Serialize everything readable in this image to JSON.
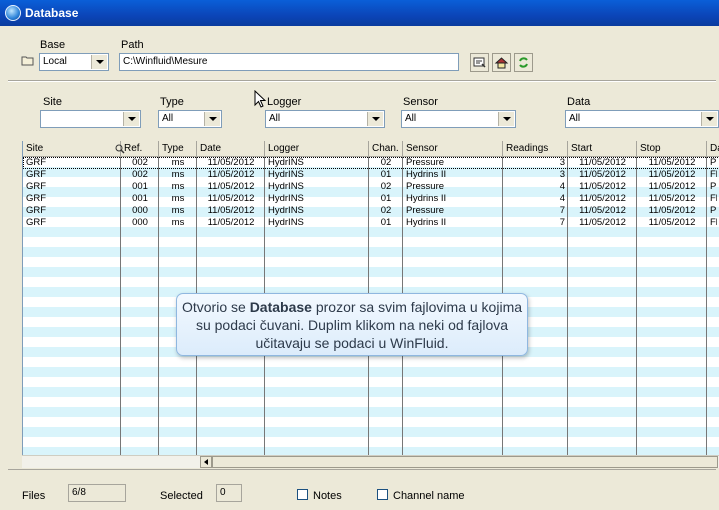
{
  "window": {
    "title": "Database"
  },
  "top": {
    "base_label": "Base",
    "base_value": "Local",
    "path_label": "Path",
    "path_value": "C:\\Winfluid\\Mesure"
  },
  "filters": {
    "site_label": "Site",
    "site_value": "",
    "type_label": "Type",
    "type_value": "All",
    "logger_label": "Logger",
    "logger_value": "All",
    "sensor_label": "Sensor",
    "sensor_value": "All",
    "data_label": "Data",
    "data_value": "All"
  },
  "table": {
    "columns": [
      "Site",
      "Ref.",
      "Type",
      "Date",
      "Logger",
      "Chan.",
      "Sensor",
      "Readings",
      "Start",
      "Stop",
      "Da"
    ],
    "rows": [
      [
        "GRF",
        "002",
        "ms",
        "11/05/2012",
        "HydrINS",
        "02",
        "Pressure",
        "3",
        "11/05/2012",
        "11/05/2012",
        "Pr"
      ],
      [
        "GRF",
        "002",
        "ms",
        "11/05/2012",
        "HydrINS",
        "01",
        "Hydrins II",
        "3",
        "11/05/2012",
        "11/05/2012",
        "Flo"
      ],
      [
        "GRF",
        "001",
        "ms",
        "11/05/2012",
        "HydrINS",
        "02",
        "Pressure",
        "4",
        "11/05/2012",
        "11/05/2012",
        "Pr"
      ],
      [
        "GRF",
        "001",
        "ms",
        "11/05/2012",
        "HydrINS",
        "01",
        "Hydrins II",
        "4",
        "11/05/2012",
        "11/05/2012",
        "Flo"
      ],
      [
        "GRF",
        "000",
        "ms",
        "11/05/2012",
        "HydrINS",
        "02",
        "Pressure",
        "7",
        "11/05/2012",
        "11/05/2012",
        "Pr"
      ],
      [
        "GRF",
        "000",
        "ms",
        "11/05/2012",
        "HydrINS",
        "01",
        "Hydrins II",
        "7",
        "11/05/2012",
        "11/05/2012",
        "Flo"
      ]
    ]
  },
  "tooltip": {
    "part1": "Otvorio se ",
    "bold": "Database",
    "part2": " prozor sa svim fajlovima u kojima su podaci čuvani. Duplim klikom na neki od fajlova učitavaju se podaci u WinFluid."
  },
  "status": {
    "files_label": "Files",
    "files_value": "6/8",
    "selected_label": "Selected",
    "selected_value": "0",
    "notes_label": "Notes",
    "channel_label": "Channel name"
  },
  "icons": {
    "folder": "folder-icon",
    "sort": "magnifier-sort-icon",
    "browse": "browse-icon",
    "home": "home-icon",
    "refresh": "refresh-icon"
  }
}
